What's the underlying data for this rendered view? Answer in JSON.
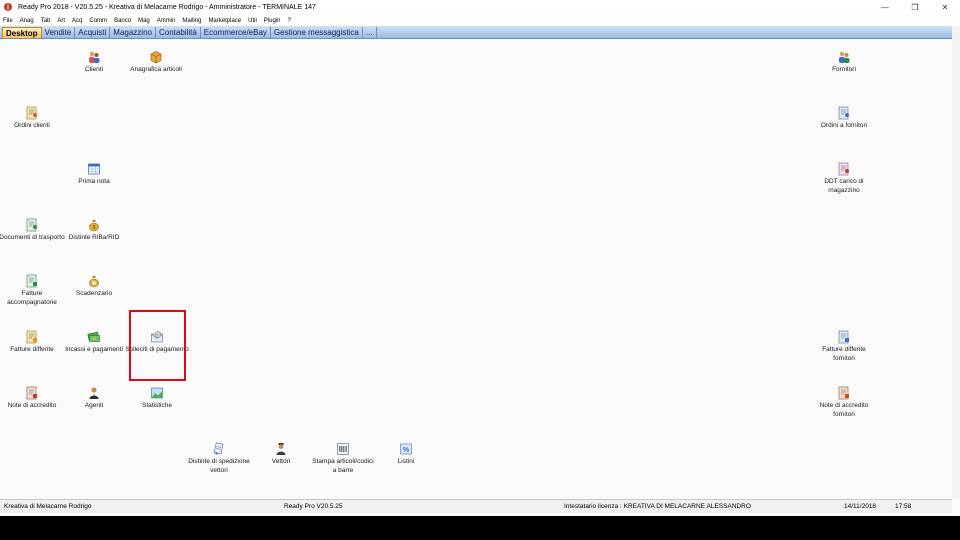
{
  "window": {
    "title": "Ready Pro 2018 - V20.5.25 - Kreativa di Melacarne Rodrigo - Amministratore - TERMINALE 147"
  },
  "menu": [
    "File",
    "Anag",
    "Tab",
    "Art",
    "Acq",
    "Comm",
    "Banco",
    "Mag",
    "Ammin",
    "Mailing",
    "Marketplace",
    "Util",
    "Plugin",
    "?"
  ],
  "tabs": [
    "Desktop",
    "Vendite",
    "Acquisti",
    "Magazzino",
    "Contabilità",
    "Ecommerce/eBay",
    "Gestione messaggistica",
    "..."
  ],
  "icons": {
    "clienti": "Clienti",
    "anagrafica_articoli": "Anagrafica articoli",
    "fornitori": "Fornitori",
    "ordini_clienti": "Ordini clienti",
    "ordini_fornitori": "Ordini a fornitori",
    "prima_nota": "Prima nota",
    "ddt_carico": "DDT carico di magazzino",
    "documenti_trasporto": "Documenti di trasporto",
    "distinte_riba": "Distinte RiBa/RID",
    "fatture_accompagnatorie": "Fatture accompagnatorie",
    "scadenzario": "Scadenzario",
    "fatture_differite": "Fatture differite",
    "incassi_pagamenti": "Incassi e pagamenti",
    "solleciti_pagamento": "Solleciti di pagamento",
    "fatture_differite_fornitori": "Fatture differite fornitori",
    "note_accredito": "Note di accredito",
    "agenti": "Agenti",
    "statistiche": "Statistiche",
    "note_accredito_fornitori": "Note di accredito fornitori",
    "distinte_spedizione": "Distinte di spedizione vettori",
    "vettori": "Vettori",
    "stampa_articoli": "Stampa articoli/codici a barre",
    "listini": "Listini"
  },
  "status": {
    "company": "Kreativa di Melacarne Rodrigo",
    "version": "Ready Pro V20.5.25",
    "license": "Intestatario licenza : KREATIVA DI MELACARNE ALESSANDRO",
    "date": "14/11/2018",
    "time": "17:58"
  },
  "colors": {
    "highlight": "#e30613",
    "tab_active": "#f6c25a",
    "tab_bar": "#9dbbe4"
  }
}
